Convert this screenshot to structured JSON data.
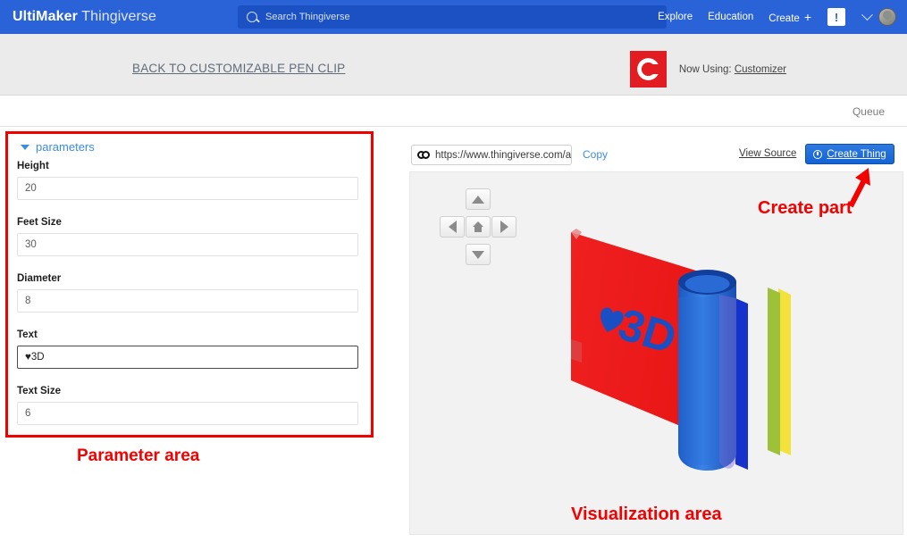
{
  "topbar": {
    "brand_bold": "UltiMaker",
    "brand_light": "Thingiverse",
    "search_placeholder": "Search Thingiverse",
    "nav": [
      {
        "label": "Explore"
      },
      {
        "label": "Education"
      },
      {
        "label": "Create"
      }
    ],
    "create_plus": "+",
    "notification_badge": "!",
    "accent_color": "#2a62d8"
  },
  "band": {
    "back_link": "BACK TO CUSTOMIZABLE PEN CLIP",
    "now_using_prefix": "Now Using:",
    "now_using_value": "Customizer",
    "logo_letter": "C",
    "logo_color": "#e21c21"
  },
  "queue": {
    "label": "Queue"
  },
  "parameters": {
    "section_title": "parameters",
    "fields": [
      {
        "label": "Height",
        "value": "20",
        "focused": false
      },
      {
        "label": "Feet Size",
        "value": "30",
        "focused": false
      },
      {
        "label": "Diameter",
        "value": "8",
        "focused": false
      },
      {
        "label": "Text",
        "value": "♥3D",
        "focused": true
      },
      {
        "label": "Text Size",
        "value": "6",
        "focused": false
      }
    ]
  },
  "toolbar": {
    "url_value": "https://www.thingiverse.com/app",
    "copy_label": "Copy",
    "view_source_label": "View Source",
    "create_thing_label": "Create Thing"
  },
  "viewer": {
    "controls": [
      {
        "name": "rotate-up",
        "glyph": "▲"
      },
      {
        "name": "rotate-left",
        "glyph": "◀"
      },
      {
        "name": "reset-home",
        "glyph": "⌂"
      },
      {
        "name": "rotate-right",
        "glyph": "▶"
      },
      {
        "name": "rotate-down",
        "glyph": "▼"
      }
    ],
    "model_text": "♥3D",
    "model_colors": {
      "plate": "#f22020",
      "text": "#1a4fc4",
      "cylinder": "#1f63cc",
      "strip_yellow": "#f5e23a",
      "strip_green": "#9dc23a",
      "strip_blue": "#1533cc"
    }
  },
  "annotations": {
    "parameter_area": "Parameter area",
    "visualization_area": "Visualization area",
    "create_part": "Create part",
    "color": "#f30000"
  }
}
